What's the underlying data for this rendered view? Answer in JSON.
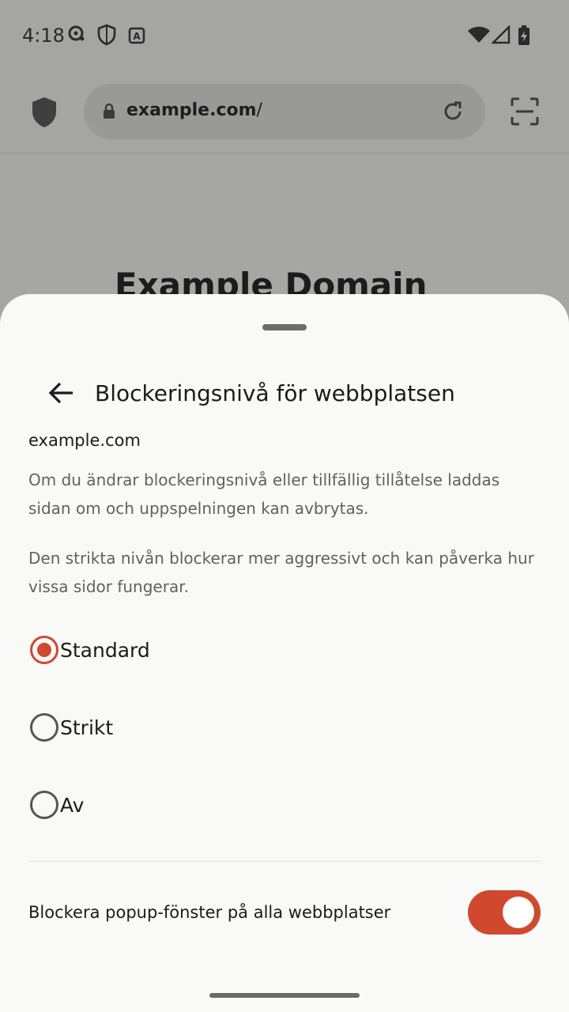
{
  "status_bar": {
    "time": "4:18"
  },
  "browser": {
    "url_host": "example.com",
    "url_path": "/",
    "page_heading": "Example Domain"
  },
  "sheet": {
    "title": "Blockeringsnivå för webbplatsen",
    "site": "example.com",
    "paragraph1": "Om du ändrar blockeringsnivå eller tillfällig tillåtelse laddas sidan om och uppspelningen kan avbrytas.",
    "paragraph2": "Den strikta nivån blockerar mer aggressivt och kan påverka hur vissa sidor fungerar.",
    "options": [
      {
        "label": "Standard",
        "selected": true
      },
      {
        "label": "Strikt",
        "selected": false
      },
      {
        "label": "Av",
        "selected": false
      }
    ],
    "popup_label": "Blockera popup-fönster på alla webbplatser",
    "popup_enabled": true
  },
  "colors": {
    "accent": "#d1482f",
    "sheet_bg": "#f9f9f7",
    "scrim": "#a6a6a5"
  },
  "icons": [
    "cast-icon",
    "vpn-shield-icon",
    "a-icon",
    "wifi-icon",
    "signal-icon",
    "battery-icon",
    "shield-icon",
    "lock-icon",
    "reload-icon",
    "scan-icon",
    "back-arrow-icon"
  ]
}
